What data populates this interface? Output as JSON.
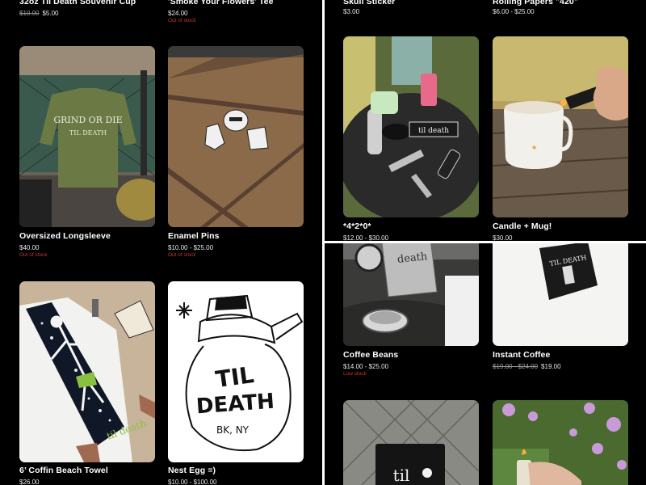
{
  "panel_left": {
    "top_row": [
      {
        "title": "32oz Til Death Souvenir Cup",
        "compare_price": "$10.00",
        "price": "$5.00",
        "stock": ""
      },
      {
        "title": "'Smoke Your Flowers' Tee",
        "compare_price": "",
        "price": "$24.00",
        "stock": "Out of stock"
      }
    ],
    "products": [
      {
        "title": "Oversized Longsleeve",
        "compare_price": "",
        "price": "$40.00",
        "stock": "Out of stock",
        "image": "green-longsleeve-shirt-photo",
        "image_text": [
          "GRIND OR DIE",
          "TIL DEATH"
        ]
      },
      {
        "title": "Enamel Pins",
        "compare_price": "",
        "price": "$10.00 - $25.00",
        "stock": "Out of stock",
        "image": "enamel-pins-on-bench-photo",
        "image_text": []
      },
      {
        "title": "6’ Coffin Beach Towel",
        "compare_price": "",
        "price": "$26.00",
        "stock": "",
        "image": "coffin-skeleton-beach-towel-photo",
        "image_text": [
          "til death"
        ]
      },
      {
        "title": "Nest Egg =)",
        "compare_price": "",
        "price": "$10.00 - $100.00",
        "stock": "",
        "image": "coffee-pot-illustration",
        "image_text": [
          "TIL",
          "DEATH",
          "BK, NY"
        ]
      }
    ]
  },
  "panel_right_top": {
    "top_row": [
      {
        "title": "Skull Sticker",
        "compare_price": "",
        "price": "$3.00",
        "stock": ""
      },
      {
        "title": "Rolling Papers \"420\"",
        "compare_price": "",
        "price": "$6.00 - $25.00",
        "stock": ""
      }
    ],
    "products": [
      {
        "title": "*4*2*0*",
        "compare_price": "",
        "price": "$12.00 - $30.00",
        "stock": "",
        "image": "420-accessories-bundle-photo",
        "image_text": [
          "til death"
        ]
      },
      {
        "title": "Candle + Mug!",
        "compare_price": "",
        "price": "$30.00",
        "stock": "",
        "image": "candle-mug-lighter-photo",
        "image_text": []
      }
    ]
  },
  "panel_right_bottom": {
    "products": [
      {
        "title": "Coffee Beans",
        "compare_price": "",
        "price": "$14.00 - $25.00",
        "stock": "Low stock",
        "image": "coffee-beans-motorcycle-photo",
        "image_text": [
          "death"
        ]
      },
      {
        "title": "Instant Coffee",
        "compare_price": "$19.00 - $24.00",
        "price": "$19.00",
        "stock": "",
        "image": "instant-coffee-box-photo",
        "image_text": [
          "TIL DEATH"
        ]
      },
      {
        "title": "",
        "compare_price": "",
        "price": "",
        "stock": "",
        "image": "coffee-can-fence-photo",
        "image_text": [
          "til"
        ]
      },
      {
        "title": "",
        "compare_price": "",
        "price": "",
        "stock": "",
        "image": "lighter-flowers-photo",
        "image_text": []
      }
    ]
  },
  "colors": {
    "background": "#000000",
    "text": "#ffffff",
    "muted_price": "#9a9a9a",
    "stock_warning": "#c0392b"
  }
}
